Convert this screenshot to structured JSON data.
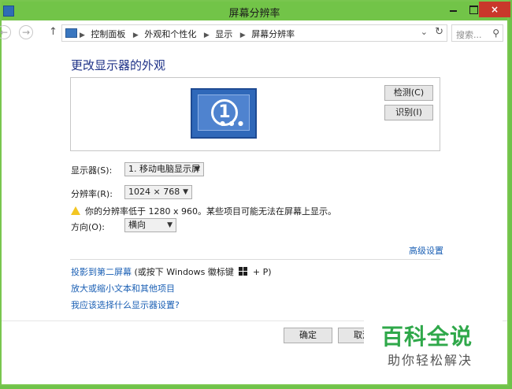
{
  "window": {
    "title": "屏幕分辨率"
  },
  "titlebar": {
    "close_glyph": "×"
  },
  "nav": {
    "back_glyph": "←",
    "forward_glyph": "→",
    "up_glyph": "↑",
    "breadcrumbs": [
      "控制面板",
      "外观和个性化",
      "显示",
      "屏幕分辨率"
    ],
    "search_placeholder": "搜索..."
  },
  "content": {
    "heading": "更改显示器的外观",
    "monitor_number": "1",
    "detect_button": "检测(C)",
    "identify_button": "识别(I)",
    "display_label": "显示器(S):",
    "display_value": "1. 移动电脑显示屏",
    "resolution_label": "分辨率(R):",
    "resolution_value": "1024 × 768",
    "warning_text": "你的分辨率低于 1280 x 960。某些项目可能无法在屏幕上显示。",
    "orientation_label": "方向(O):",
    "orientation_value": "横向",
    "advanced_link": "高级设置",
    "project_link": "投影到第二屏幕",
    "project_hint_before": " (或按下 Windows 徽标键 ",
    "project_hint_after": " + P)",
    "text_size_link": "放大或缩小文本和其他项目",
    "which_settings_link": "我应该选择什么显示器设置?"
  },
  "footer": {
    "ok_button": "确定",
    "cancel_button": "取消"
  },
  "watermark": {
    "main": "百科全说",
    "sub": "助你轻松解决"
  },
  "colors": {
    "titlebar": "#72c448",
    "link": "#1a5fb4",
    "heading": "#1e3287",
    "watermark_green": "#2fa84a"
  }
}
